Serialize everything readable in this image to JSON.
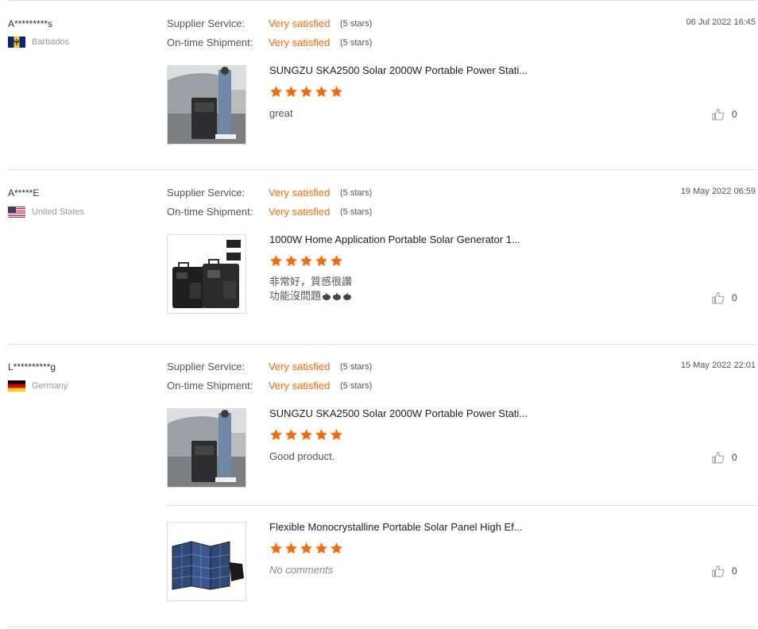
{
  "reviews": [
    {
      "buyer": "A*********s",
      "country": "Barbados",
      "supplier_label": "Supplier Service:",
      "supplier_value": "Very satisfied",
      "supplier_stars": "(5 stars)",
      "shipment_label": "On-time Shipment:",
      "shipment_value": "Very satisfied",
      "shipment_stars": "(5 stars)",
      "date": "06 Jul 2022 16:45",
      "products": [
        {
          "title": "SUNGZU SKA2500 Solar 2000W Portable Power Stati...",
          "rating": 5,
          "comment": "great",
          "likes": "0",
          "thumb": "power-station-photo"
        }
      ]
    },
    {
      "buyer": "A*****E",
      "country": "United States",
      "supplier_label": "Supplier Service:",
      "supplier_value": "Very satisfied",
      "supplier_stars": "(5 stars)",
      "shipment_label": "On-time Shipment:",
      "shipment_value": "Very satisfied",
      "shipment_stars": "(5 stars)",
      "date": "19 May 2022 06:59",
      "products": [
        {
          "title": "1000W Home Application Portable Solar Generator 1...",
          "rating": 5,
          "comment_line1": "非常好，質感很讚",
          "comment_line2": "功能沒問題",
          "likes": "0",
          "thumb": "generator-photo"
        }
      ]
    },
    {
      "buyer": "L**********g",
      "country": "Germany",
      "supplier_label": "Supplier Service:",
      "supplier_value": "Very satisfied",
      "supplier_stars": "(5 stars)",
      "shipment_label": "On-time Shipment:",
      "shipment_value": "Very satisfied",
      "shipment_stars": "(5 stars)",
      "date": "15 May 2022 22:01",
      "products": [
        {
          "title": "SUNGZU SKA2500 Solar 2000W Portable Power Stati...",
          "rating": 5,
          "comment": "Good product.",
          "likes": "0",
          "thumb": "power-station-photo"
        },
        {
          "title": "Flexible Monocrystalline Portable Solar Panel High Ef...",
          "rating": 5,
          "comment": "No comments",
          "likes": "0",
          "thumb": "solar-panel-photo"
        }
      ]
    }
  ],
  "colors": {
    "accent": "#ff6a00",
    "divider": "#e0e0e0"
  }
}
